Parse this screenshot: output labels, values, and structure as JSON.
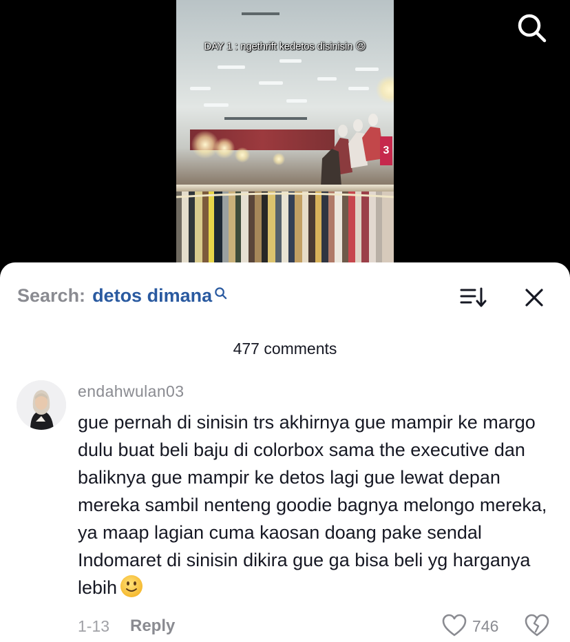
{
  "video": {
    "caption": "DAY 1 : ngethrift kedetos disinisin 😃",
    "sign_text": "3"
  },
  "top_bar": {
    "search_icon": "search-icon"
  },
  "search_bar": {
    "label": "Search:",
    "term": "detos dimana",
    "term_icon": "small-search-icon",
    "sort_icon": "sort-icon",
    "close_icon": "close-icon"
  },
  "comments_header": {
    "count_text": "477 comments"
  },
  "comment": {
    "username": "endahwulan03",
    "text": "gue pernah di sinisin trs akhirnya gue mampir ke margo dulu buat beli baju di colorbox sama the executive dan baliknya gue mampir ke detos lagi gue lewat depan mereka sambil nenteng goodie bagnya melongo mereka, ya maap lagian cuma kaosan doang pake sendal Indomaret di sinisin dikira gue ga bisa beli yg harganya lebih",
    "emoji": "slightly-smiling-face",
    "date": "1-13",
    "reply_label": "Reply",
    "like_count": "746",
    "like_icon": "heart-outline-icon",
    "dislike_icon": "broken-heart-icon"
  },
  "colors": {
    "search_term": "#2a5aa0",
    "secondary_text": "#8a8b91",
    "primary_text": "#161823",
    "background_dark": "#000000"
  }
}
